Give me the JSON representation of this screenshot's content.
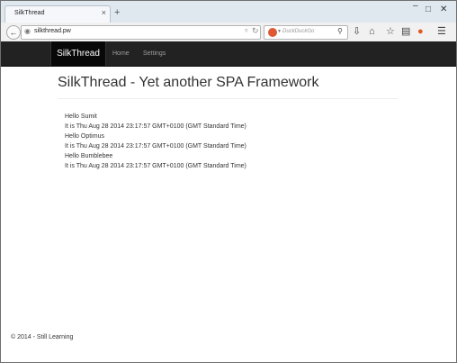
{
  "browser": {
    "tab_title": "SilkThread",
    "tab_close_glyph": "×",
    "new_tab_glyph": "+",
    "url": "silkthread.pw",
    "search_placeholder": "DuckDuckGo",
    "window_controls": [
      "–",
      "□",
      "✕"
    ]
  },
  "navbar": {
    "brand": "SilkThread",
    "links": [
      "Home",
      "Settings"
    ],
    "background": "#222222",
    "brand_background": "#080808"
  },
  "page": {
    "title": "SilkThread - Yet another SPA Framework",
    "lines": [
      "Hello Sumit",
      "It is Thu Aug 28 2014 23:17:57 GMT+0100 (GMT Standard Time)",
      "Hello Optimus",
      "It is Thu Aug 28 2014 23:17:57 GMT+0100 (GMT Standard Time)",
      "Hello Bumblebee",
      "It is Thu Aug 28 2014 23:17:57 GMT+0100 (GMT Standard Time)"
    ]
  },
  "footer": {
    "text": "© 2014 - Still Learning"
  },
  "icons": {
    "back": "back-arrow-icon",
    "globe": "globe-icon",
    "reload": "reload-icon",
    "search": "magnifier-icon",
    "download": "download-icon",
    "home": "home-icon",
    "bookmark": "star-icon",
    "clipboard": "clipboard-icon",
    "addon": "duckduckgo-addon-icon",
    "menu": "hamburger-menu-icon"
  }
}
